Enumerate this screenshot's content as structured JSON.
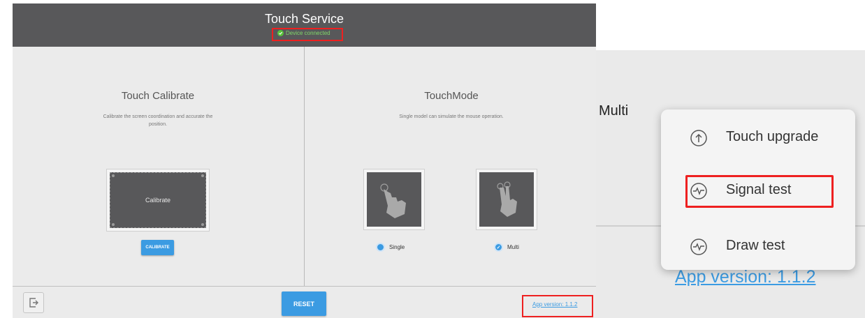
{
  "app": {
    "title": "Touch Service",
    "status": "Device connected",
    "colors": {
      "header": "#58585a",
      "accent": "#3b9be2",
      "connected": "#57c23a",
      "highlight": "#ee2020"
    }
  },
  "calibrate": {
    "title": "Touch Calibrate",
    "description": "Calibrate the screen coordination and accurate the position.",
    "area_label": "Calibrate",
    "button_label": "CALIBRATE"
  },
  "mode": {
    "title": "TouchMode",
    "description": "Single model can simulate the mouse operation.",
    "options": [
      {
        "label": "Single",
        "selected": false,
        "icon": "single-finger-icon"
      },
      {
        "label": "Multi",
        "selected": true,
        "icon": "two-finger-icon"
      }
    ]
  },
  "footer": {
    "exit_icon": "exit-icon",
    "reset_label": "RESET",
    "version": "App version: 1.1.2"
  },
  "zoom": {
    "mode_label": "Multi",
    "version": "App version: 1.1.2",
    "menu": [
      {
        "label": "Touch upgrade",
        "icon": "upgrade-arrow-icon"
      },
      {
        "label": "Signal test",
        "icon": "signal-test-icon"
      },
      {
        "label": "Draw test",
        "icon": "draw-test-icon"
      }
    ]
  }
}
